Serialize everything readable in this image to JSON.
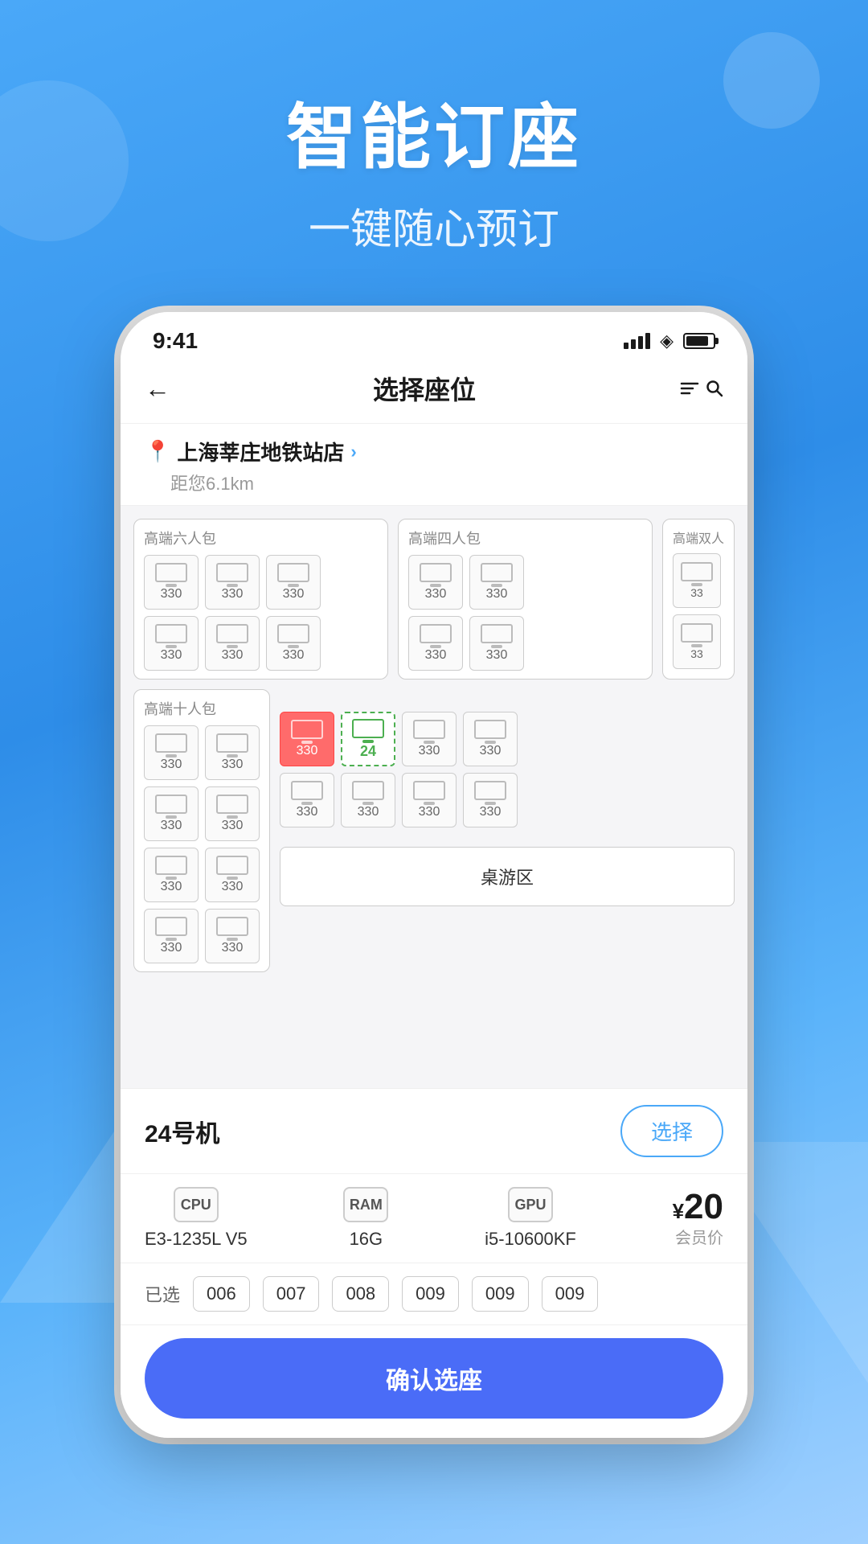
{
  "background": {
    "gradient_start": "#4aa8f8",
    "gradient_end": "#5ab3fa"
  },
  "header": {
    "title": "智能订座",
    "subtitle": "一键随心预订"
  },
  "phone": {
    "status_bar": {
      "time": "9:41"
    },
    "nav": {
      "back_icon": "←",
      "title": "选择座位",
      "search_icon": "≡🔍"
    },
    "location": {
      "pin_icon": "📍",
      "name": "上海莘庄地铁站店",
      "arrow": ">",
      "distance": "距您6.1km"
    },
    "sections": [
      {
        "id": "s1",
        "label": "高端六人包"
      },
      {
        "id": "s2",
        "label": "高端四人包"
      },
      {
        "id": "s3",
        "label": "高端双人"
      },
      {
        "id": "s4",
        "label": "高端十人包"
      }
    ],
    "seat_price": "330",
    "selected_seat_num": "24",
    "machine": {
      "name": "24号机",
      "select_btn": "选择",
      "cpu_icon": "CPU",
      "cpu_label": "E3-1235L V5",
      "ram_icon": "RAM",
      "ram_label": "16G",
      "gpu_icon": "GPU",
      "gpu_label": "i5-10600KF",
      "price": "¥20",
      "price_label": "会员价"
    },
    "already_selected_label": "已选",
    "selected_seats": [
      "006",
      "007",
      "008",
      "009",
      "009",
      "009"
    ],
    "confirm_btn": "确认选座",
    "board_game_label": "桌游区"
  }
}
